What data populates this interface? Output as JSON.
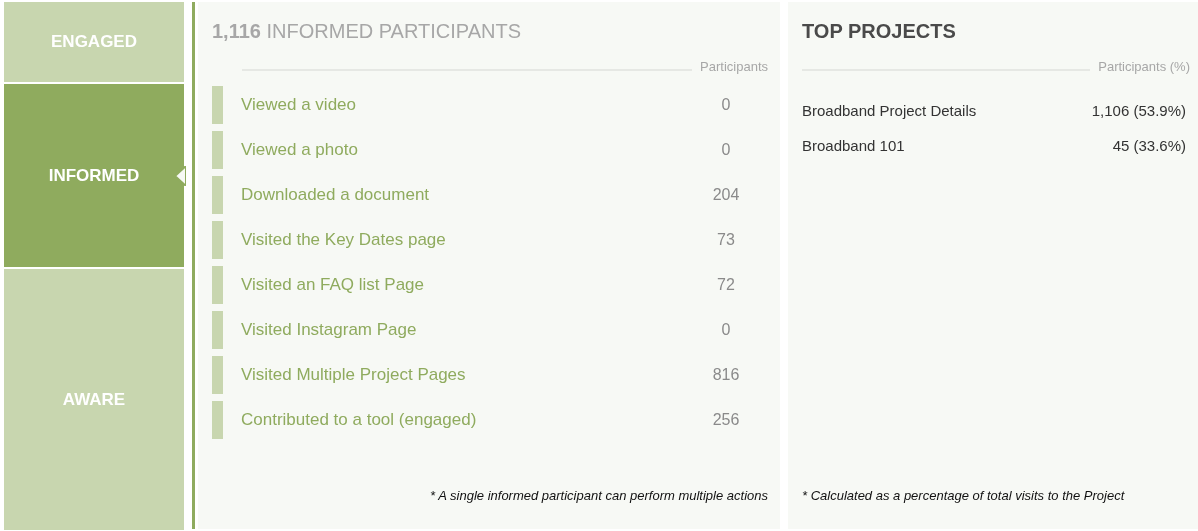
{
  "stages": [
    {
      "label": "ENGAGED",
      "selected": false
    },
    {
      "label": "INFORMED",
      "selected": true
    },
    {
      "label": "AWARE",
      "selected": false
    }
  ],
  "actions_panel": {
    "title": "**1,116** INFORMED PARTICIPANTS",
    "column_header": "Participants",
    "rows": [
      {
        "label": "Viewed a video",
        "value": "0"
      },
      {
        "label": "Viewed a photo",
        "value": "0"
      },
      {
        "label": "Downloaded a document",
        "value": "204"
      },
      {
        "label": "Visited the Key Dates page",
        "value": "73"
      },
      {
        "label": "Visited an FAQ list Page",
        "value": "72"
      },
      {
        "label": "Visited Instagram Page",
        "value": "0"
      },
      {
        "label": "Visited Multiple Project Pages",
        "value": "816"
      },
      {
        "label": "Contributed to a tool (engaged)",
        "value": "256"
      }
    ],
    "footnote": "* A single informed participant can perform multiple actions"
  },
  "top_projects": {
    "title": "TOP PROJECTS",
    "column_header": "Participants (%)",
    "rows": [
      {
        "name": "Broadband Project Details",
        "value": "1,106 (53.9%)"
      },
      {
        "name": "Broadband 101",
        "value": "45 (33.6%)"
      }
    ],
    "footnote": "* Calculated as a percentage of total visits to the Project"
  }
}
